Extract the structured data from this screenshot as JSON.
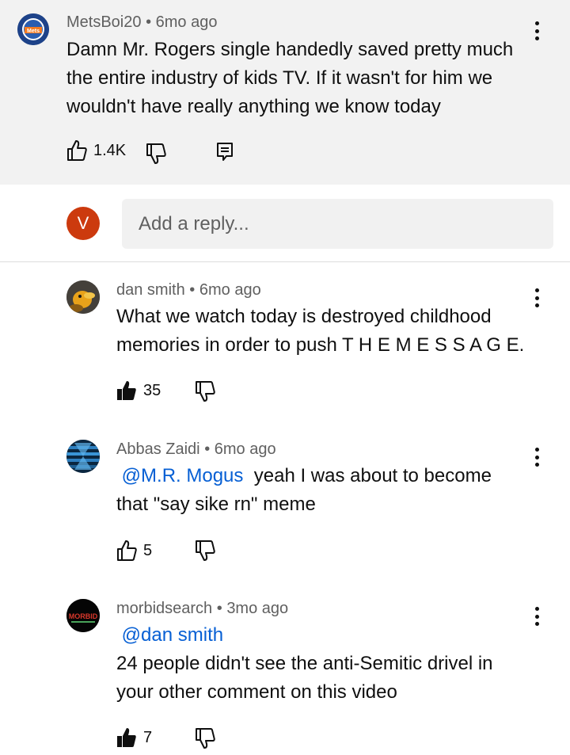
{
  "parent_comment": {
    "author": "MetsBoi20",
    "time": "6mo ago",
    "text": "Damn Mr. Rogers single handedly  saved pretty much the entire industry of kids TV. If it wasn't for him we wouldn't have really anything we know today",
    "likes": "1.4K",
    "avatar_logo": "Mets"
  },
  "reply_box": {
    "avatar_letter": "V",
    "placeholder": "Add a reply..."
  },
  "replies": [
    {
      "author": "dan smith",
      "time": "6mo ago",
      "mention": "",
      "text": "What we watch today is destroyed childhood memories in order to push T H E M E S S A G E.",
      "likes": "35",
      "liked": true
    },
    {
      "author": "Abbas Zaidi",
      "time": "6mo ago",
      "mention": "@M.R. Mogus",
      "text": "yeah I was about to become that \"say sike rn\" meme",
      "likes": "5",
      "liked": false
    },
    {
      "author": "morbidsearch",
      "time": "3mo ago",
      "mention": "@dan smith",
      "text": "24 people didn't see the anti-Semitic drivel in your other comment on this video",
      "likes": "7",
      "liked": true,
      "avatar_logo": "MORBID"
    }
  ],
  "separator": "•"
}
